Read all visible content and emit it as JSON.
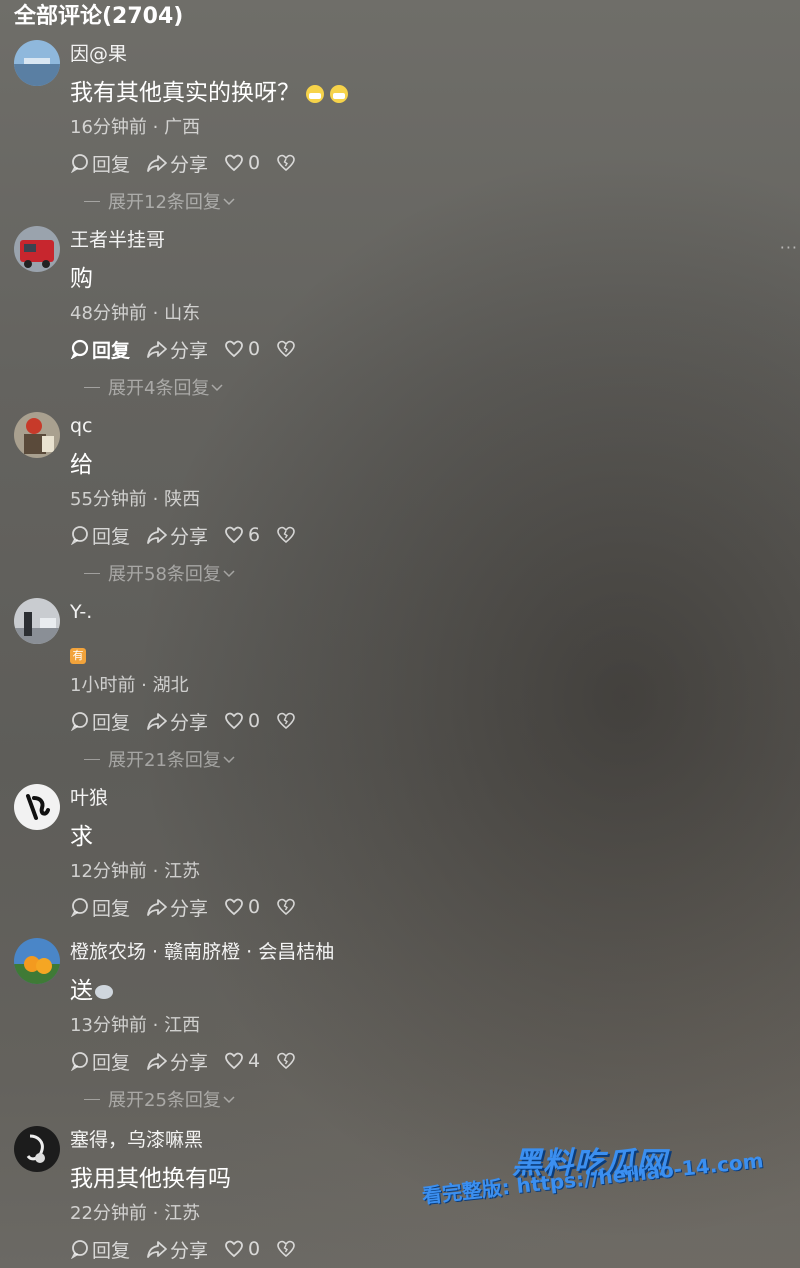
{
  "header": {
    "title": "全部评论(2704)"
  },
  "more_label": "···",
  "action_labels": {
    "reply": "回复",
    "share": "分享"
  },
  "comments": [
    {
      "username": "因@果",
      "content": "我有其他真实的换呀？",
      "meta": "16分钟前 · 广西",
      "likes": "0",
      "expand": "展开12条回复"
    },
    {
      "username": "王者半挂哥",
      "content": "购",
      "meta": "48分钟前 · 山东",
      "likes": "0",
      "expand": "展开4条回复"
    },
    {
      "username": "qc",
      "content": "给",
      "meta": "55分钟前 · 陕西",
      "likes": "6",
      "expand": "展开58条回复"
    },
    {
      "username": "Y-.",
      "content": "有",
      "meta": "1小时前 · 湖北",
      "likes": "0",
      "expand": "展开21条回复"
    },
    {
      "username": "叶狼",
      "content": "求",
      "meta": "12分钟前 · 江苏",
      "likes": "0",
      "expand": ""
    },
    {
      "username": "橙旅农场 · 赣南脐橙 · 会昌桔柚",
      "content": "送",
      "meta": "13分钟前 · 江西",
      "likes": "4",
      "expand": "展开25条回复"
    },
    {
      "username": "塞得，乌漆嘛黑",
      "content": "我用其他换有吗",
      "meta": "22分钟前 · 江苏",
      "likes": "0",
      "expand": ""
    }
  ],
  "watermark": {
    "logo": "黑料吃瓜网",
    "url": "看完整版: https://heiliao-14.com"
  }
}
